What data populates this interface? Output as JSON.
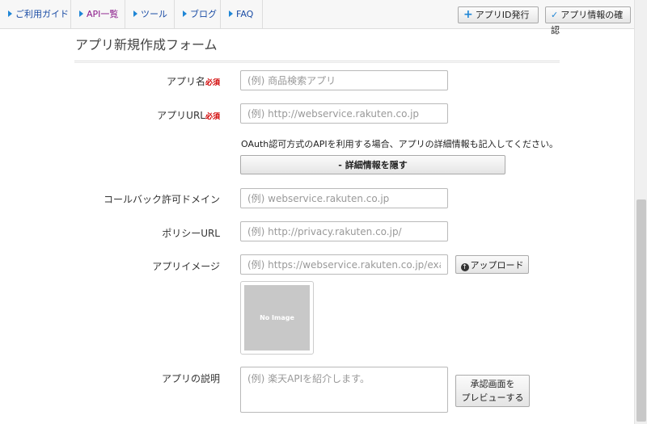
{
  "nav": {
    "items": [
      {
        "label": "ご利用ガイド"
      },
      {
        "label": "API一覧"
      },
      {
        "label": "ツール"
      },
      {
        "label": "ブログ"
      },
      {
        "label": "FAQ"
      }
    ],
    "issue_button": "アプリID発行",
    "confirm_button": "アプリ情報の確認"
  },
  "form": {
    "title": "アプリ新規作成フォーム",
    "required_mark": "必須",
    "app_name": {
      "label": "アプリ名",
      "placeholder": "(例) 商品検索アプリ"
    },
    "app_url": {
      "label": "アプリURL",
      "placeholder": "(例) http://webservice.rakuten.co.jp"
    },
    "oauth_note": "OAuth認可方式のAPIを利用する場合、アプリの詳細情報も記入してください。",
    "toggle_details_button": "- 詳細情報を隠す",
    "callback_domain": {
      "label": "コールバック許可ドメイン",
      "placeholder": "(例) webservice.rakuten.co.jp"
    },
    "policy_url": {
      "label": "ポリシーURL",
      "placeholder": "(例) http://privacy.rakuten.co.jp/"
    },
    "app_image": {
      "label": "アプリイメージ",
      "placeholder": "(例) https://webservice.rakuten.co.jp/example.jpg",
      "upload_button": "アップロード",
      "no_image_text": "No Image"
    },
    "app_description": {
      "label": "アプリの説明",
      "placeholder": "(例) 楽天APIを紹介します。"
    },
    "preview_button_line1": "承認画面を",
    "preview_button_line2": "プレビューする"
  }
}
